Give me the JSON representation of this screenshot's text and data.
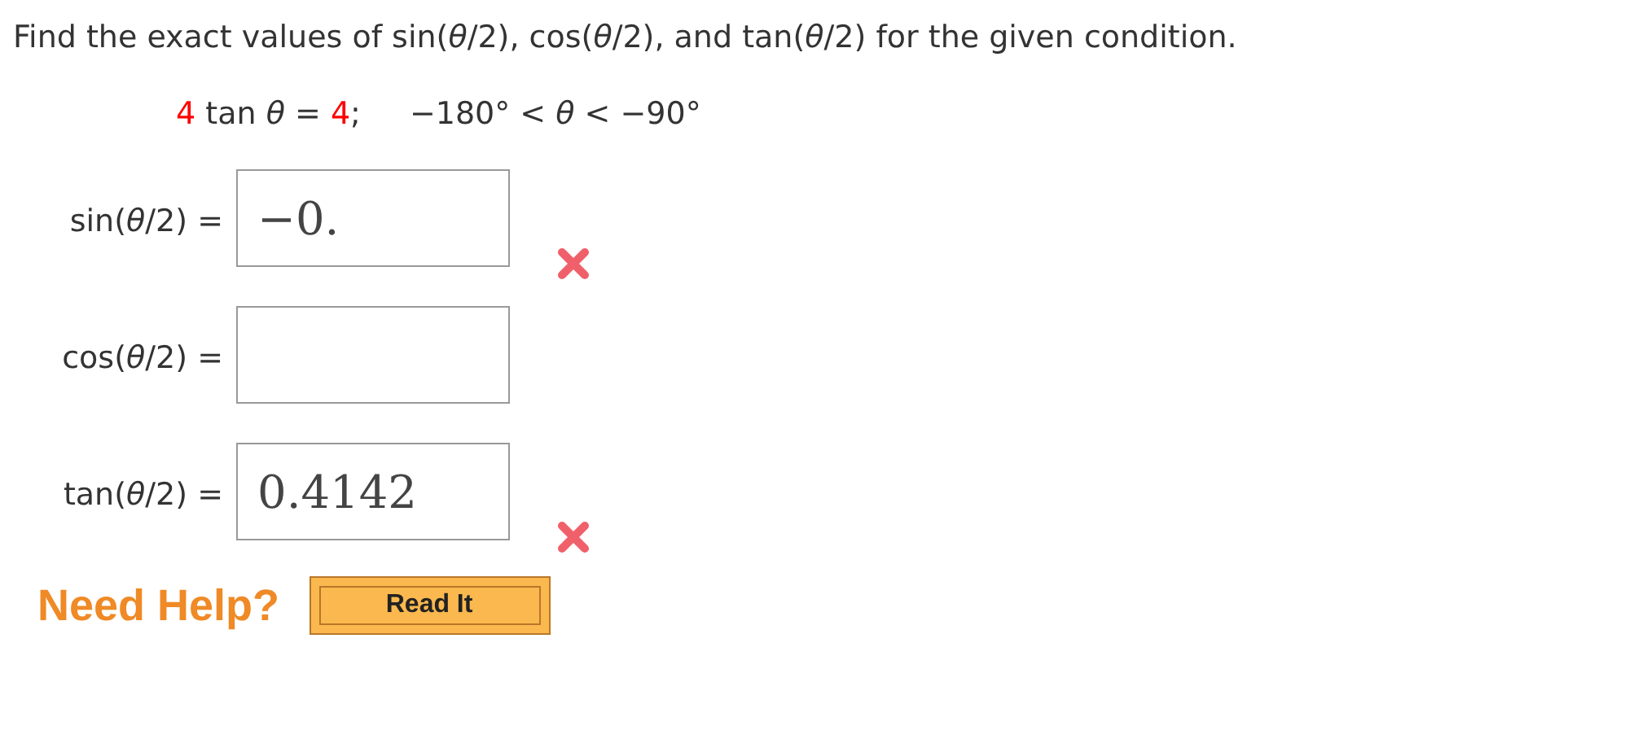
{
  "question": "Find the exact values of sin(*θ*/2), cos(*θ*/2), and tan(*θ*/2) for the given condition.",
  "condition": {
    "equation_parts": [
      {
        "text": "4",
        "highlight": true
      },
      {
        "text": " tan *θ* = ",
        "highlight": false
      },
      {
        "text": "4",
        "highlight": true
      },
      {
        "text": ";",
        "highlight": false
      }
    ],
    "range": "−180° < *θ* < −90°"
  },
  "answers": [
    {
      "label": "sin(*θ*/2) =",
      "value": "−0.",
      "incorrect": true
    },
    {
      "label": "cos(*θ*/2) =",
      "incorrect": false
    },
    {
      "label": "tan(*θ*/2) =",
      "value": "0.4142",
      "incorrect": true
    }
  ],
  "help": {
    "label": "Need Help?",
    "buttons": [
      "Read It"
    ]
  }
}
